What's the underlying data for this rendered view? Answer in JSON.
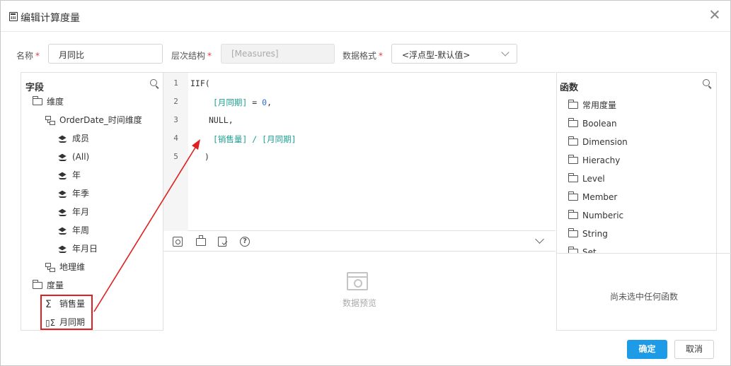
{
  "dialog": {
    "title": "编辑计算度量"
  },
  "form": {
    "name_label": "名称",
    "name_value": "月同比",
    "hierarchy_label": "层次结构",
    "hierarchy_value": "[Measures]",
    "format_label": "数据格式",
    "format_value": "<浮点型-默认值>",
    "required_mark": "*"
  },
  "fields": {
    "header": "字段",
    "items": [
      {
        "label": "维度",
        "icon": "folder-icon"
      },
      {
        "label": "OrderDate_时间维度",
        "icon": "hierarchy-icon"
      },
      {
        "label": "成员",
        "icon": "layers-icon"
      },
      {
        "label": "(All)",
        "icon": "layers-icon"
      },
      {
        "label": "年",
        "icon": "layers-icon"
      },
      {
        "label": "年季",
        "icon": "layers-icon"
      },
      {
        "label": "年月",
        "icon": "layers-icon"
      },
      {
        "label": "年周",
        "icon": "layers-icon"
      },
      {
        "label": "年月日",
        "icon": "layers-icon"
      },
      {
        "label": "地理维",
        "icon": "hierarchy-icon"
      },
      {
        "label": "度量",
        "icon": "folder-icon"
      },
      {
        "label": "销售量",
        "icon": "sigma-icon"
      },
      {
        "label": "月同期",
        "icon": "calculated-measure-icon"
      }
    ]
  },
  "editor": {
    "line_numbers": [
      "1",
      "2",
      "3",
      "4",
      "5"
    ],
    "lines": {
      "l1": "IIF(",
      "l2_member": "[月同期]",
      "l2_op": " = ",
      "l2_num": "0",
      "l2_end": ",",
      "l3": "NULL,",
      "l4_member_a": "[销售量]",
      "l4_op": " / ",
      "l4_member_b": "[月同期]",
      "l5": ")"
    }
  },
  "toolbar": {
    "icons": [
      "format-icon",
      "clipboard-icon",
      "check-syntax-icon",
      "help-icon"
    ],
    "help_glyph": "?"
  },
  "preview": {
    "text": "数据预览"
  },
  "functions": {
    "header": "函数",
    "items": [
      "常用度量",
      "Boolean",
      "Dimension",
      "Hierachy",
      "Level",
      "Member",
      "Numberic",
      "String",
      "Set"
    ],
    "empty_text": "尚未选中任何函数"
  },
  "buttons": {
    "ok": "确定",
    "cancel": "取消"
  },
  "colors": {
    "accent": "#1e9be6",
    "annotation_red": "#e02020",
    "code_member": "#1a9d8f",
    "code_number": "#2a6bd4"
  }
}
